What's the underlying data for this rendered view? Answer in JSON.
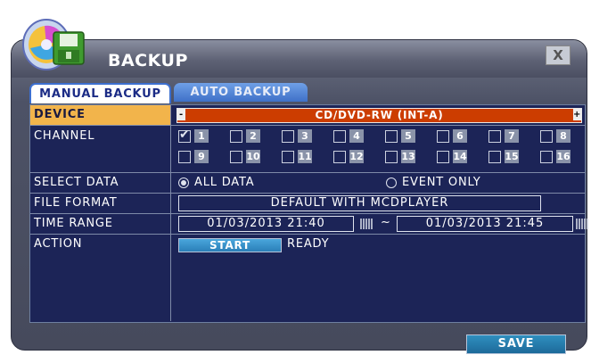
{
  "window": {
    "title": "BACKUP",
    "close_label": "X"
  },
  "tabs": [
    {
      "label": "MANUAL BACKUP",
      "active": true
    },
    {
      "label": "AUTO BACKUP",
      "active": false
    }
  ],
  "fields": {
    "device": {
      "label": "DEVICE",
      "value": "CD/DVD-RW (INT-A)",
      "left_button": "-",
      "right_button": "+"
    },
    "channel": {
      "label": "CHANNEL",
      "items": [
        {
          "num": "1",
          "checked": true
        },
        {
          "num": "2",
          "checked": false
        },
        {
          "num": "3",
          "checked": false
        },
        {
          "num": "4",
          "checked": false
        },
        {
          "num": "5",
          "checked": false
        },
        {
          "num": "6",
          "checked": false
        },
        {
          "num": "7",
          "checked": false
        },
        {
          "num": "8",
          "checked": false
        },
        {
          "num": "9",
          "checked": false
        },
        {
          "num": "10",
          "checked": false
        },
        {
          "num": "11",
          "checked": false
        },
        {
          "num": "12",
          "checked": false
        },
        {
          "num": "13",
          "checked": false
        },
        {
          "num": "14",
          "checked": false
        },
        {
          "num": "15",
          "checked": false
        },
        {
          "num": "16",
          "checked": false
        }
      ]
    },
    "select_data": {
      "label": "SELECT DATA",
      "options": [
        {
          "text": "ALL DATA",
          "selected": true
        },
        {
          "text": "EVENT ONLY",
          "selected": false
        }
      ]
    },
    "file_format": {
      "label": "FILE FORMAT",
      "value": "DEFAULT WITH MCDPLAYER"
    },
    "time_range": {
      "label": "TIME RANGE",
      "start": "01/03/2013 21:40",
      "separator": "~",
      "end": "01/03/2013 21:45"
    },
    "action": {
      "label": "ACTION",
      "button": "START",
      "status": "READY"
    }
  },
  "footer": {
    "save_label": "SAVE"
  },
  "colors": {
    "device_bar": "#cc3d00",
    "active_row": "#f2b44b",
    "panel": "#1c2457",
    "accent": "#3c6fcf"
  },
  "icons": {
    "logo": "backup-disc-logo",
    "calendar": "calendar-icon"
  }
}
